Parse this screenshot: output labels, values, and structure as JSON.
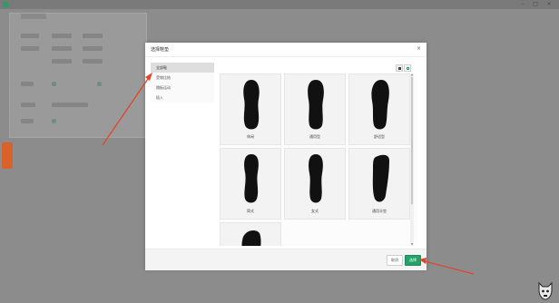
{
  "window": {
    "title": "",
    "controls": {
      "minimize": "–",
      "maximize": "□",
      "close": "×"
    }
  },
  "modal": {
    "title": "选择鞋垫",
    "close_label": "×",
    "view_toggle": {
      "grid_icon": "grid-view-icon",
      "list_icon": "list-view-icon"
    },
    "categories": [
      {
        "label": "全部鞋",
        "active": true
      },
      {
        "label": "受物比结",
        "active": false
      },
      {
        "label": "踏板运动",
        "active": false
      },
      {
        "label": "插入",
        "active": false
      }
    ],
    "items": [
      {
        "label": "休闲"
      },
      {
        "label": "通用型"
      },
      {
        "label": "舒适型"
      },
      {
        "label": "简式"
      },
      {
        "label": "女式"
      },
      {
        "label": "通用半垫"
      },
      {
        "label": ""
      }
    ],
    "cancel_label": "取消",
    "confirm_label": "选择"
  },
  "colors": {
    "accent": "#26a269",
    "annotation": "#e0452b",
    "side_tab": "#d9622b"
  }
}
